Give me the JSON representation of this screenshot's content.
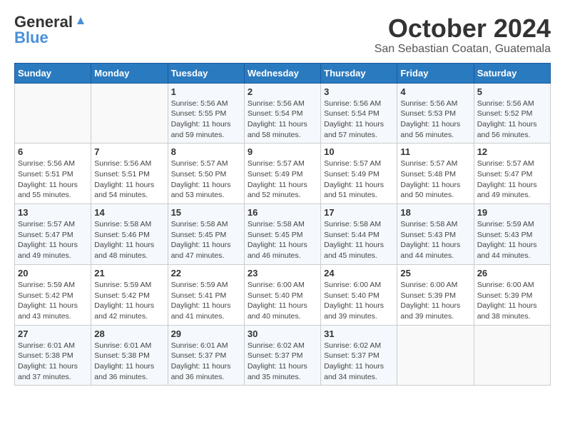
{
  "logo": {
    "general": "General",
    "blue": "Blue"
  },
  "title": "October 2024",
  "location": "San Sebastian Coatan, Guatemala",
  "days_header": [
    "Sunday",
    "Monday",
    "Tuesday",
    "Wednesday",
    "Thursday",
    "Friday",
    "Saturday"
  ],
  "weeks": [
    [
      {
        "day": "",
        "info": ""
      },
      {
        "day": "",
        "info": ""
      },
      {
        "day": "1",
        "info": "Sunrise: 5:56 AM\nSunset: 5:55 PM\nDaylight: 11 hours and 59 minutes."
      },
      {
        "day": "2",
        "info": "Sunrise: 5:56 AM\nSunset: 5:54 PM\nDaylight: 11 hours and 58 minutes."
      },
      {
        "day": "3",
        "info": "Sunrise: 5:56 AM\nSunset: 5:54 PM\nDaylight: 11 hours and 57 minutes."
      },
      {
        "day": "4",
        "info": "Sunrise: 5:56 AM\nSunset: 5:53 PM\nDaylight: 11 hours and 56 minutes."
      },
      {
        "day": "5",
        "info": "Sunrise: 5:56 AM\nSunset: 5:52 PM\nDaylight: 11 hours and 56 minutes."
      }
    ],
    [
      {
        "day": "6",
        "info": "Sunrise: 5:56 AM\nSunset: 5:51 PM\nDaylight: 11 hours and 55 minutes."
      },
      {
        "day": "7",
        "info": "Sunrise: 5:56 AM\nSunset: 5:51 PM\nDaylight: 11 hours and 54 minutes."
      },
      {
        "day": "8",
        "info": "Sunrise: 5:57 AM\nSunset: 5:50 PM\nDaylight: 11 hours and 53 minutes."
      },
      {
        "day": "9",
        "info": "Sunrise: 5:57 AM\nSunset: 5:49 PM\nDaylight: 11 hours and 52 minutes."
      },
      {
        "day": "10",
        "info": "Sunrise: 5:57 AM\nSunset: 5:49 PM\nDaylight: 11 hours and 51 minutes."
      },
      {
        "day": "11",
        "info": "Sunrise: 5:57 AM\nSunset: 5:48 PM\nDaylight: 11 hours and 50 minutes."
      },
      {
        "day": "12",
        "info": "Sunrise: 5:57 AM\nSunset: 5:47 PM\nDaylight: 11 hours and 49 minutes."
      }
    ],
    [
      {
        "day": "13",
        "info": "Sunrise: 5:57 AM\nSunset: 5:47 PM\nDaylight: 11 hours and 49 minutes."
      },
      {
        "day": "14",
        "info": "Sunrise: 5:58 AM\nSunset: 5:46 PM\nDaylight: 11 hours and 48 minutes."
      },
      {
        "day": "15",
        "info": "Sunrise: 5:58 AM\nSunset: 5:45 PM\nDaylight: 11 hours and 47 minutes."
      },
      {
        "day": "16",
        "info": "Sunrise: 5:58 AM\nSunset: 5:45 PM\nDaylight: 11 hours and 46 minutes."
      },
      {
        "day": "17",
        "info": "Sunrise: 5:58 AM\nSunset: 5:44 PM\nDaylight: 11 hours and 45 minutes."
      },
      {
        "day": "18",
        "info": "Sunrise: 5:58 AM\nSunset: 5:43 PM\nDaylight: 11 hours and 44 minutes."
      },
      {
        "day": "19",
        "info": "Sunrise: 5:59 AM\nSunset: 5:43 PM\nDaylight: 11 hours and 44 minutes."
      }
    ],
    [
      {
        "day": "20",
        "info": "Sunrise: 5:59 AM\nSunset: 5:42 PM\nDaylight: 11 hours and 43 minutes."
      },
      {
        "day": "21",
        "info": "Sunrise: 5:59 AM\nSunset: 5:42 PM\nDaylight: 11 hours and 42 minutes."
      },
      {
        "day": "22",
        "info": "Sunrise: 5:59 AM\nSunset: 5:41 PM\nDaylight: 11 hours and 41 minutes."
      },
      {
        "day": "23",
        "info": "Sunrise: 6:00 AM\nSunset: 5:40 PM\nDaylight: 11 hours and 40 minutes."
      },
      {
        "day": "24",
        "info": "Sunrise: 6:00 AM\nSunset: 5:40 PM\nDaylight: 11 hours and 39 minutes."
      },
      {
        "day": "25",
        "info": "Sunrise: 6:00 AM\nSunset: 5:39 PM\nDaylight: 11 hours and 39 minutes."
      },
      {
        "day": "26",
        "info": "Sunrise: 6:00 AM\nSunset: 5:39 PM\nDaylight: 11 hours and 38 minutes."
      }
    ],
    [
      {
        "day": "27",
        "info": "Sunrise: 6:01 AM\nSunset: 5:38 PM\nDaylight: 11 hours and 37 minutes."
      },
      {
        "day": "28",
        "info": "Sunrise: 6:01 AM\nSunset: 5:38 PM\nDaylight: 11 hours and 36 minutes."
      },
      {
        "day": "29",
        "info": "Sunrise: 6:01 AM\nSunset: 5:37 PM\nDaylight: 11 hours and 36 minutes."
      },
      {
        "day": "30",
        "info": "Sunrise: 6:02 AM\nSunset: 5:37 PM\nDaylight: 11 hours and 35 minutes."
      },
      {
        "day": "31",
        "info": "Sunrise: 6:02 AM\nSunset: 5:37 PM\nDaylight: 11 hours and 34 minutes."
      },
      {
        "day": "",
        "info": ""
      },
      {
        "day": "",
        "info": ""
      }
    ]
  ]
}
